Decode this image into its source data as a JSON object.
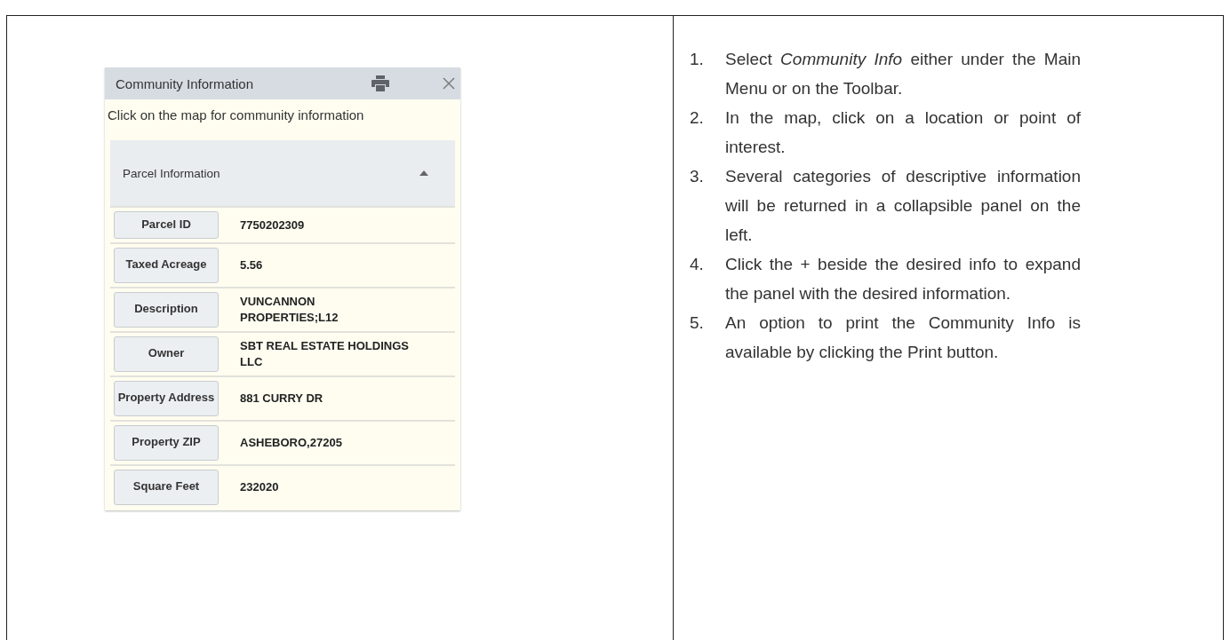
{
  "panel": {
    "title": "Community Information",
    "hint": "Click on the map for community information",
    "section": {
      "title": "Parcel Information",
      "expanded": true,
      "rows": [
        {
          "label": "Parcel ID",
          "value": "7750202309"
        },
        {
          "label": "Taxed Acreage",
          "value": "5.56"
        },
        {
          "label": "Description",
          "value": "VUNCANNON PROPERTIES;L12"
        },
        {
          "label": "Owner",
          "value": "SBT REAL ESTATE HOLDINGS LLC"
        },
        {
          "label": "Property Address",
          "value": "881 CURRY DR"
        },
        {
          "label": "Property ZIP",
          "value": "ASHEBORO,27205"
        },
        {
          "label": "Square Feet",
          "value": "232020"
        }
      ]
    }
  },
  "steps": [
    {
      "number": "1.",
      "text": "Select *Community Info* either under the Main Menu or on the Toolbar."
    },
    {
      "number": "2.",
      "text": "In the map, click on a location or point of interest."
    },
    {
      "number": "3.",
      "text": "Several categories of descriptive information will be returned in a collapsible panel on the left."
    },
    {
      "number": "4.",
      "text": "Click the + beside the desired info to expand the panel with the desired information."
    },
    {
      "number": "5.",
      "text": "An option to print the Community Info is available by clicking the Print button."
    }
  ]
}
